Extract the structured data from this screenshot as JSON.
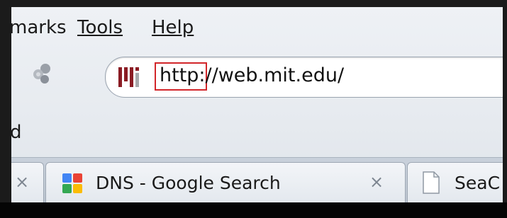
{
  "menu": {
    "bookmarks_label": "marks",
    "tools_label": "Tools",
    "help_label": "Help"
  },
  "navbar": {
    "url": "http://web.mit.edu/",
    "highlighted_part": "http:",
    "site_icon": "mit-logo-icon",
    "plugin_icon": "plugin-icon"
  },
  "bookmarks_toolbar": {
    "label": "d"
  },
  "tabs": [
    {
      "title": "",
      "close_glyph": "×"
    },
    {
      "title": "DNS - Google Search",
      "close_glyph": "×",
      "icon": "google-favicon-icon"
    },
    {
      "title": "SeaC",
      "icon": "document-icon"
    }
  ],
  "colors": {
    "highlight_border": "#d2262a",
    "mit_red": "#8b1c24",
    "chrome_bg": "#e6eaef"
  }
}
